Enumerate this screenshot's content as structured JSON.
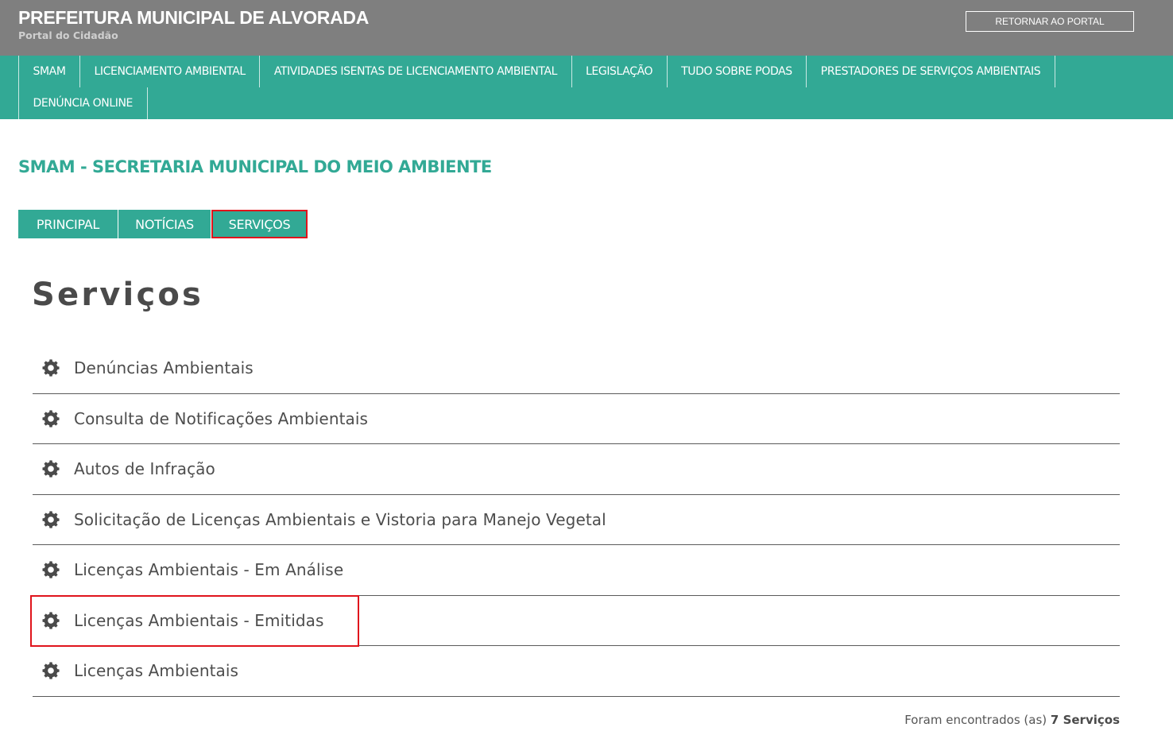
{
  "header": {
    "title": "PREFEITURA MUNICIPAL DE ALVORADA",
    "subtitle": "Portal do Cidadão",
    "return_button": "RETORNAR AO PORTAL"
  },
  "nav": {
    "row1": [
      {
        "label": "SMAM"
      },
      {
        "label": "LICENCIAMENTO AMBIENTAL"
      },
      {
        "label": "ATIVIDADES ISENTAS DE LICENCIAMENTO AMBIENTAL"
      },
      {
        "label": "LEGISLAÇÃO"
      },
      {
        "label": "TUDO SOBRE PODAS"
      },
      {
        "label": "PRESTADORES DE SERVIÇOS AMBIENTAIS"
      }
    ],
    "row2": [
      {
        "label": "DENÚNCIA ONLINE"
      }
    ]
  },
  "section": {
    "title": "SMAM - SECRETARIA MUNICIPAL DO MEIO AMBIENTE"
  },
  "tabs": [
    {
      "label": "PRINCIPAL"
    },
    {
      "label": "NOTÍCIAS"
    },
    {
      "label": "SERVIÇOS",
      "highlighted": true
    }
  ],
  "main": {
    "heading": "Serviços",
    "services": [
      {
        "label": "Denúncias Ambientais",
        "icon": "gear-icon"
      },
      {
        "label": "Consulta de Notificações Ambientais",
        "icon": "gear-icon"
      },
      {
        "label": "Autos de Infração",
        "icon": "gear-icon"
      },
      {
        "label": "Solicitação de Licenças Ambientais e Vistoria para Manejo Vegetal",
        "icon": "gear-icon"
      },
      {
        "label": "Licenças Ambientais - Em Análise",
        "icon": "gear-icon"
      },
      {
        "label": "Licenças Ambientais - Emitidas",
        "icon": "gear-icon",
        "highlighted": true
      },
      {
        "label": "Licenças Ambientais",
        "icon": "gear-icon"
      }
    ],
    "count_prefix": "Foram encontrados (as)",
    "count_value": "7 Serviços"
  },
  "colors": {
    "header_bg": "#7f7f7f",
    "accent": "#32a995",
    "highlight": "#e0141c",
    "text": "#4d4d4d"
  }
}
